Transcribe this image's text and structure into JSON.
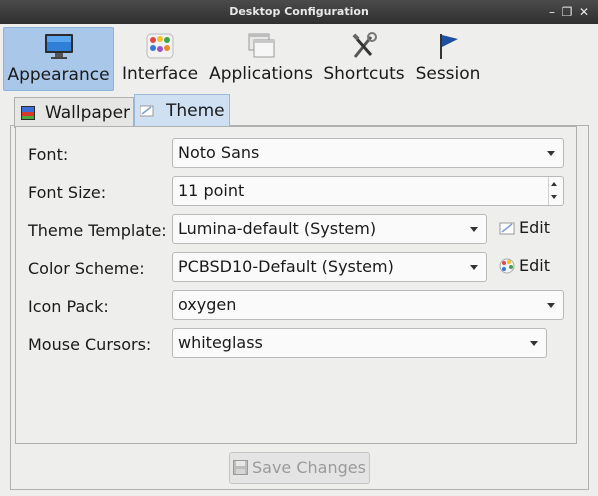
{
  "window": {
    "title": "Desktop Configuration"
  },
  "toolbar": {
    "items": [
      {
        "label": "Appearance",
        "icon": "monitor-icon",
        "active": true
      },
      {
        "label": "Interface",
        "icon": "palette-icon",
        "active": false
      },
      {
        "label": "Applications",
        "icon": "windows-icon",
        "active": false
      },
      {
        "label": "Shortcuts",
        "icon": "tools-icon",
        "active": false
      },
      {
        "label": "Session",
        "icon": "flag-icon",
        "active": false
      }
    ]
  },
  "tabs": [
    {
      "label": "Wallpaper",
      "selected": false
    },
    {
      "label": "Theme",
      "selected": true
    }
  ],
  "theme": {
    "font": {
      "label": "Font:",
      "value": "Noto Sans"
    },
    "font_size": {
      "label": "Font Size:",
      "value": "11 point"
    },
    "theme_template": {
      "label": "Theme Template:",
      "value": "Lumina-default (System)",
      "edit_label": "Edit"
    },
    "color_scheme": {
      "label": "Color Scheme:",
      "value": "PCBSD10-Default (System)",
      "edit_label": "Edit"
    },
    "icon_pack": {
      "label": "Icon Pack:",
      "value": "oxygen"
    },
    "mouse_cursors": {
      "label": "Mouse Cursors:",
      "value": "whiteglass"
    }
  },
  "footer": {
    "save_label": "Save Changes",
    "save_enabled": false
  },
  "colors": {
    "titlebar": "#3a3a3a",
    "active_tool": "#a9c7e8",
    "active_tab": "#cfe0f3"
  }
}
